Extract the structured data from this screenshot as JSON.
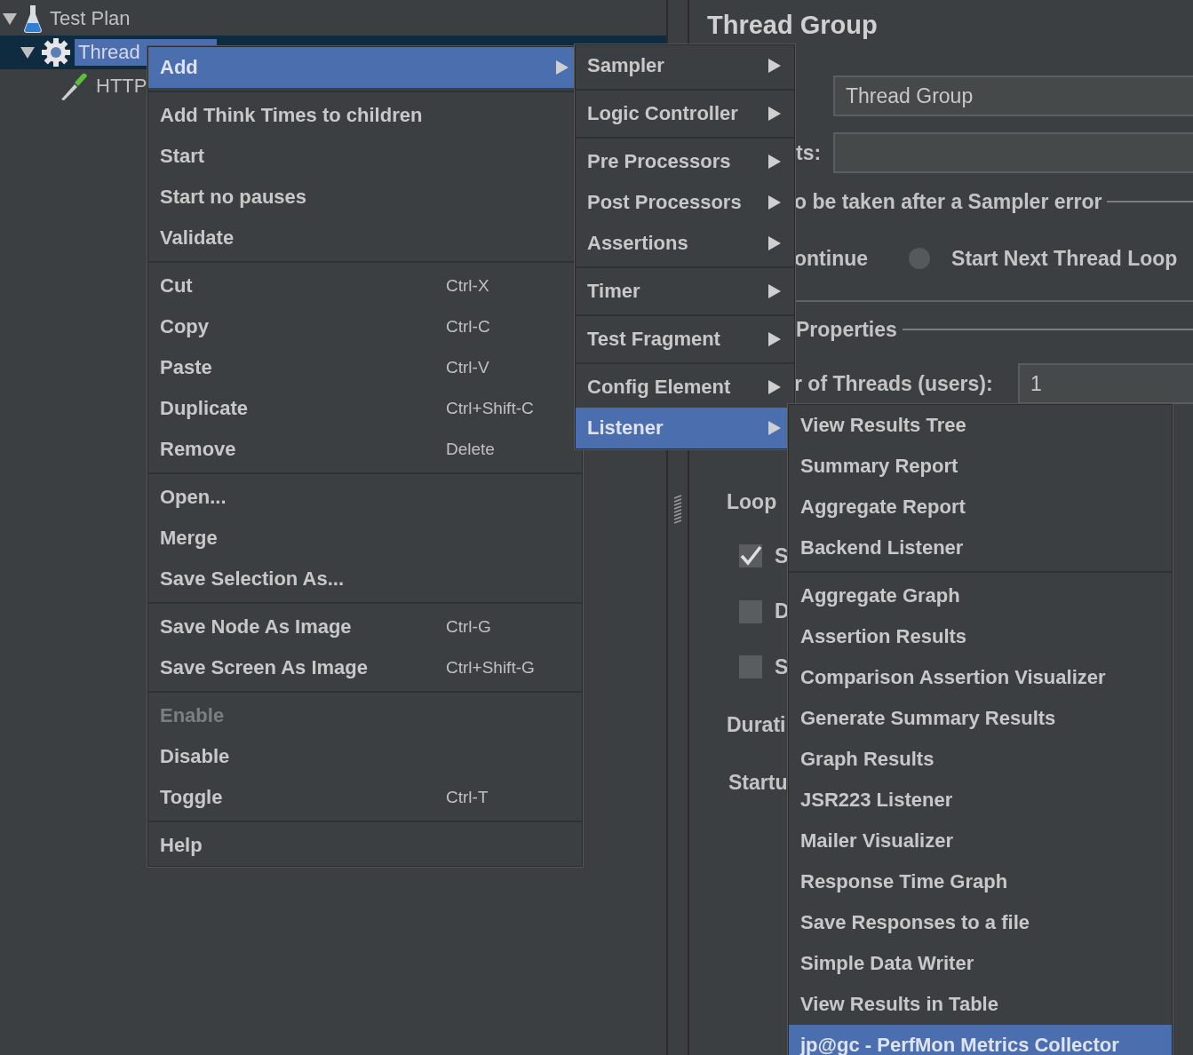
{
  "tree": [
    {
      "kind": "plan",
      "label": "Test Plan",
      "expanded": true,
      "selected": false,
      "children": [
        {
          "kind": "group",
          "label": "Thread",
          "expanded": true,
          "selected": true,
          "children": [
            {
              "kind": "sampler",
              "label": "HTTP",
              "selected": false
            }
          ]
        }
      ]
    }
  ],
  "panel": {
    "title": "Thread Group",
    "name_value": "Thread Group",
    "comments_label": "ts:",
    "error_section": "o be taken after a Sampler error",
    "error_option": "ontinue",
    "radio": {
      "label": "Start Next Thread Loop",
      "selected": false
    },
    "properties_section": "Properties",
    "threads_label": "r of Threads (users):",
    "threads_value": "1",
    "loop_label": "Loop",
    "checkboxes": [
      {
        "label": "S",
        "checked": true
      },
      {
        "label": "D",
        "checked": false
      },
      {
        "label": "S",
        "checked": false
      }
    ],
    "duration_label": "Durati",
    "startup_label": "Startu"
  },
  "context_menu": [
    {
      "kind": "item",
      "label": "Add",
      "submenu": true,
      "selected": true,
      "disabled": false
    },
    {
      "kind": "separator"
    },
    {
      "kind": "item",
      "label": "Add Think Times to children",
      "selected": false,
      "disabled": false
    },
    {
      "kind": "item",
      "label": "Start",
      "selected": false,
      "disabled": false
    },
    {
      "kind": "item",
      "label": "Start no pauses",
      "selected": false,
      "disabled": false
    },
    {
      "kind": "item",
      "label": "Validate",
      "selected": false,
      "disabled": false
    },
    {
      "kind": "separator"
    },
    {
      "kind": "item",
      "label": "Cut",
      "shortcut": "Ctrl-X",
      "selected": false,
      "disabled": false
    },
    {
      "kind": "item",
      "label": "Copy",
      "shortcut": "Ctrl-C",
      "selected": false,
      "disabled": false
    },
    {
      "kind": "item",
      "label": "Paste",
      "shortcut": "Ctrl-V",
      "selected": false,
      "disabled": false
    },
    {
      "kind": "item",
      "label": "Duplicate",
      "shortcut": "Ctrl+Shift-C",
      "selected": false,
      "disabled": false
    },
    {
      "kind": "item",
      "label": "Remove",
      "shortcut": "Delete",
      "selected": false,
      "disabled": false
    },
    {
      "kind": "separator"
    },
    {
      "kind": "item",
      "label": "Open...",
      "selected": false,
      "disabled": false
    },
    {
      "kind": "item",
      "label": "Merge",
      "selected": false,
      "disabled": false
    },
    {
      "kind": "item",
      "label": "Save Selection As...",
      "selected": false,
      "disabled": false
    },
    {
      "kind": "separator"
    },
    {
      "kind": "item",
      "label": "Save Node As Image",
      "shortcut": "Ctrl-G",
      "selected": false,
      "disabled": false
    },
    {
      "kind": "item",
      "label": "Save Screen As Image",
      "shortcut": "Ctrl+Shift-G",
      "selected": false,
      "disabled": false
    },
    {
      "kind": "separator"
    },
    {
      "kind": "item",
      "label": "Enable",
      "selected": false,
      "disabled": true
    },
    {
      "kind": "item",
      "label": "Disable",
      "selected": false,
      "disabled": false
    },
    {
      "kind": "item",
      "label": "Toggle",
      "shortcut": "Ctrl-T",
      "selected": false,
      "disabled": false
    },
    {
      "kind": "separator"
    },
    {
      "kind": "item",
      "label": "Help",
      "selected": false,
      "disabled": false
    }
  ],
  "add_submenu": [
    {
      "kind": "item",
      "label": "Sampler",
      "submenu": true,
      "selected": false
    },
    {
      "kind": "separator"
    },
    {
      "kind": "item",
      "label": "Logic Controller",
      "submenu": true,
      "selected": false
    },
    {
      "kind": "separator"
    },
    {
      "kind": "item",
      "label": "Pre Processors",
      "submenu": true,
      "selected": false
    },
    {
      "kind": "item",
      "label": "Post Processors",
      "submenu": true,
      "selected": false
    },
    {
      "kind": "item",
      "label": "Assertions",
      "submenu": true,
      "selected": false
    },
    {
      "kind": "separator"
    },
    {
      "kind": "item",
      "label": "Timer",
      "submenu": true,
      "selected": false
    },
    {
      "kind": "separator"
    },
    {
      "kind": "item",
      "label": "Test Fragment",
      "submenu": true,
      "selected": false
    },
    {
      "kind": "separator"
    },
    {
      "kind": "item",
      "label": "Config Element",
      "submenu": true,
      "selected": false
    },
    {
      "kind": "item",
      "label": "Listener",
      "submenu": true,
      "selected": true
    }
  ],
  "listener_submenu": [
    {
      "kind": "item",
      "label": "View Results Tree",
      "selected": false
    },
    {
      "kind": "item",
      "label": "Summary Report",
      "selected": false
    },
    {
      "kind": "item",
      "label": "Aggregate Report",
      "selected": false
    },
    {
      "kind": "item",
      "label": "Backend Listener",
      "selected": false
    },
    {
      "kind": "separator"
    },
    {
      "kind": "item",
      "label": "Aggregate Graph",
      "selected": false
    },
    {
      "kind": "item",
      "label": "Assertion Results",
      "selected": false
    },
    {
      "kind": "item",
      "label": "Comparison Assertion Visualizer",
      "selected": false
    },
    {
      "kind": "item",
      "label": "Generate Summary Results",
      "selected": false
    },
    {
      "kind": "item",
      "label": "Graph Results",
      "selected": false
    },
    {
      "kind": "item",
      "label": "JSR223 Listener",
      "selected": false
    },
    {
      "kind": "item",
      "label": "Mailer Visualizer",
      "selected": false
    },
    {
      "kind": "item",
      "label": "Response Time Graph",
      "selected": false
    },
    {
      "kind": "item",
      "label": "Save Responses to a file",
      "selected": false
    },
    {
      "kind": "item",
      "label": "Simple Data Writer",
      "selected": false
    },
    {
      "kind": "item",
      "label": "View Results in Table",
      "selected": false
    },
    {
      "kind": "item",
      "label": "jp@gc - PerfMon Metrics Collector",
      "selected": true
    }
  ]
}
